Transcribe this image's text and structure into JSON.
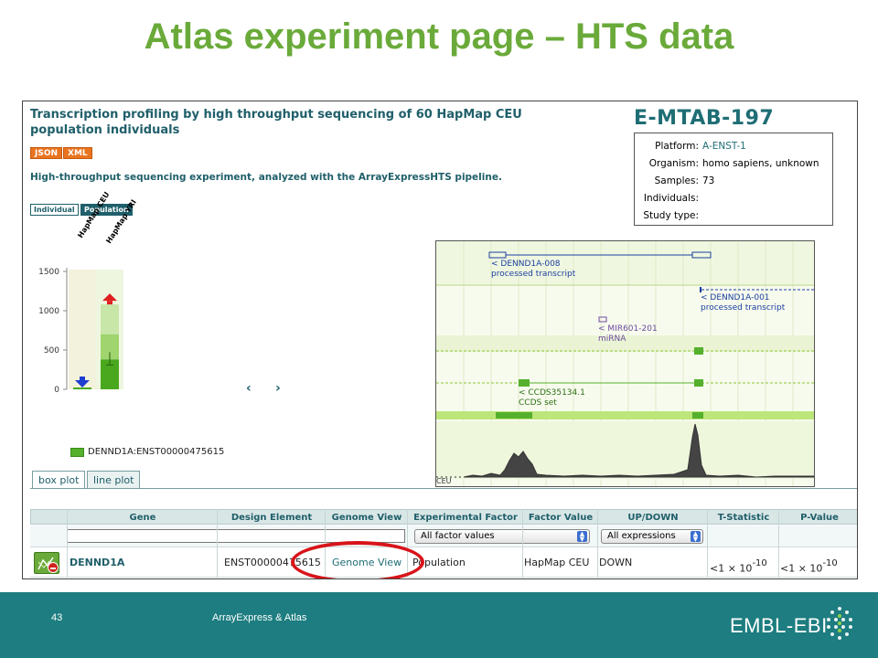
{
  "slide": {
    "title": "Atlas experiment page – HTS data",
    "page_number": "43",
    "footer_text": "ArrayExpress & Atlas",
    "logo_text": "EMBL-EBI"
  },
  "experiment": {
    "title": "Transcription profiling by high throughput sequencing of 60 HapMap CEU population individuals",
    "format_buttons": [
      "JSON",
      "XML"
    ],
    "description": "High-throughput sequencing experiment, analyzed with the ArrayExpressHTS pipeline.",
    "view_toggles": [
      {
        "label": "Individual",
        "active": false
      },
      {
        "label": "Population",
        "active": true
      }
    ],
    "accession": "E-MTAB-197",
    "info": [
      {
        "key": "Platform:",
        "value": "A-ENST-1"
      },
      {
        "key": "Organism:",
        "value": "homo sapiens, unknown"
      },
      {
        "key": "Samples:",
        "value": "73"
      },
      {
        "key": "Individuals:",
        "value": ""
      },
      {
        "key": "Study type:",
        "value": ""
      }
    ]
  },
  "chart_data": {
    "type": "bar",
    "categories": [
      "HapMap CEU",
      "HapMap YRI"
    ],
    "ylim": [
      0,
      1500
    ],
    "yticks": [
      "1500",
      "1000",
      "500",
      "0"
    ],
    "series": [
      {
        "name": "DENND1A:ENST00000475615",
        "values": [
          0,
          380
        ]
      }
    ],
    "upper_box": [
      0,
      1080
    ],
    "middle_box": [
      0,
      700
    ],
    "arrows": [
      "down",
      "up"
    ],
    "arrow_colors": [
      "#1f3fd0",
      "#e02020"
    ]
  },
  "nav": {
    "prev": "‹",
    "next": "›"
  },
  "tabs": [
    {
      "label": "box plot",
      "active": true
    },
    {
      "label": "line plot",
      "active": false
    }
  ],
  "genome_browser": {
    "tracks": [
      {
        "label": "< DENND1A-008",
        "sub": "processed transcript"
      },
      {
        "label": "< DENND1A-001",
        "sub": "processed transcript"
      },
      {
        "label": "< MIR601-201",
        "sub": "miRNA"
      },
      {
        "label": "< CCDS35134.1",
        "sub": "CCDS set"
      }
    ],
    "corner_label": "CEU"
  },
  "table": {
    "headers": [
      "Gene",
      "Design Element",
      "Genome View",
      "Experimental Factor",
      "Factor Value",
      "UP/DOWN",
      "T-Statistic",
      "P-Value"
    ],
    "filters": {
      "factor": "All factor values",
      "expression": "All expressions"
    },
    "row": {
      "gene": "DENND1A",
      "design_element": "ENST00000475615",
      "genome_view": "Genome View",
      "factor": "Population",
      "factor_value": "HapMap CEU",
      "direction": "DOWN",
      "t_statistic": "<1 × 10",
      "t_exp": "-10",
      "p_value": "<1 × 10",
      "p_exp": "-10"
    }
  }
}
